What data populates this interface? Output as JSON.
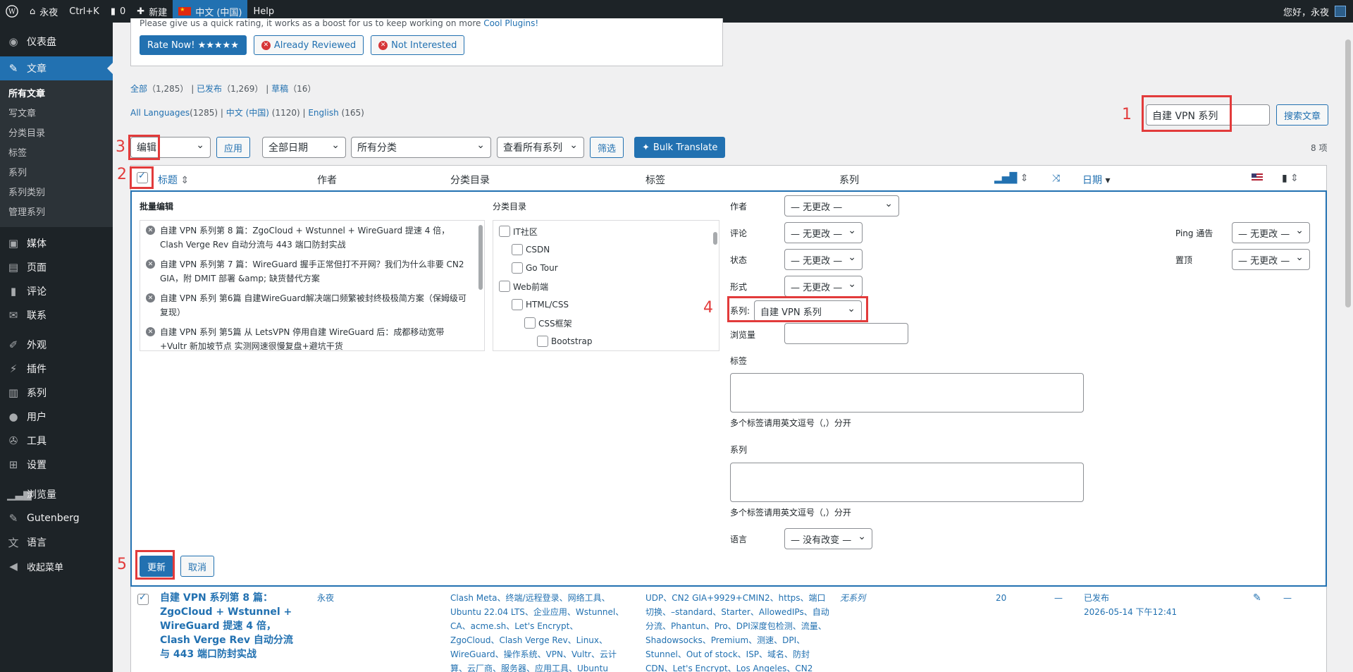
{
  "admin_bar": {
    "site": "永夜",
    "shortcut": "Ctrl+K",
    "comments": "0",
    "new": "新建",
    "language": "中文 (中国)",
    "help": "Help",
    "greeting": "您好，永夜"
  },
  "sidebar": {
    "items": [
      {
        "label": "仪表盘",
        "icon": "dashboard-icon"
      },
      {
        "label": "文章",
        "icon": "pin-icon"
      },
      {
        "label": "媒体",
        "icon": "media-icon"
      },
      {
        "label": "页面",
        "icon": "page-icon"
      },
      {
        "label": "评论",
        "icon": "comment-icon"
      },
      {
        "label": "联系",
        "icon": "mail-icon"
      },
      {
        "label": "外观",
        "icon": "brush-icon"
      },
      {
        "label": "插件",
        "icon": "plugin-icon"
      },
      {
        "label": "系列",
        "icon": "book-icon"
      },
      {
        "label": "用户",
        "icon": "user-icon"
      },
      {
        "label": "工具",
        "icon": "wrench-icon"
      },
      {
        "label": "设置",
        "icon": "settings-icon"
      },
      {
        "label": "浏览量",
        "icon": "chart-icon"
      },
      {
        "label": "Gutenberg",
        "icon": "gutenberg-icon"
      },
      {
        "label": "语言",
        "icon": "translate-icon"
      },
      {
        "label": "收起菜单",
        "icon": "collapse-icon"
      }
    ],
    "submenu": [
      "所有文章",
      "写文章",
      "分类目录",
      "标签",
      "系列",
      "系列类别",
      "管理系列"
    ]
  },
  "notice": {
    "text": "Please give us a quick rating, it works as a boost for us to keep working on more ",
    "link": "Cool Plugins!",
    "rate": "Rate Now! ★★★★★",
    "reviewed": "Already Reviewed",
    "not_interested": "Not Interested"
  },
  "status_links": {
    "all": "全部",
    "all_count": "（1,285）",
    "published": "已发布",
    "published_count": "（1,269）",
    "draft": "草稿",
    "draft_count": "（16）"
  },
  "lang_links": {
    "all": "All Languages",
    "all_count": "(1285)",
    "zh": "中文 (中国)",
    "zh_count": "(1120)",
    "en": "English",
    "en_count": "(165)"
  },
  "search": {
    "value": "自建 VPN 系列",
    "button": "搜索文章"
  },
  "filters": {
    "bulk_action": "编辑",
    "apply": "应用",
    "date": "全部日期",
    "category": "所有分类",
    "series": "查看所有系列",
    "filter": "筛选",
    "translate": "Bulk Translate",
    "count": "8 项"
  },
  "columns": {
    "title": "标题",
    "author": "作者",
    "categories": "分类目录",
    "tags": "标签",
    "series": "系列",
    "date": "日期"
  },
  "bulk_edit": {
    "heading": "批量编辑",
    "cat_heading": "分类目录",
    "posts": [
      "自建 VPN 系列第 8 篇：ZgoCloud + Wstunnel + WireGuard 提速 4 倍，Clash Verge Rev 自动分流与 443 端口防封实战",
      "自建 VPN 系列第 7 篇：WireGuard 握手正常但打不开网？我们为什么非要 CN2 GIA，附 DMIT 部署 &amp; 缺货替代方案",
      "自建 VPN 系列 第6篇 自建WireGuard解决端口频繁被封终极极简方案（保姆级可复现）",
      "自建 VPN 系列 第5篇 从 LetsVPN 停用自建 WireGuard 后：成都移动宽带+Vultr 新加坡节点 实测网速很慢复盘+避坑干货"
    ],
    "cats": [
      "IT社区",
      "CSDN",
      "Go Tour",
      "Web前端",
      "HTML/CSS",
      "CSS框架",
      "Bootstrap"
    ],
    "author_label": "作者",
    "author_value": "— 无更改 —",
    "comment_label": "评论",
    "comment_value": "— 无更改 —",
    "status_label": "状态",
    "status_value": "— 无更改 —",
    "format_label": "形式",
    "format_value": "— 无更改 —",
    "series_label": "系列:",
    "series_value": "自建 VPN 系列",
    "views_label": "浏览量",
    "tags_label": "标签",
    "tags_hint": "多个标签请用英文逗号（,）分开",
    "series2_label": "系列",
    "series2_hint": "多个标签请用英文逗号（,）分开",
    "lang_label": "语言",
    "lang_value": "— 没有改变 —",
    "ping_label": "Ping 通告",
    "ping_value": "— 无更改 —",
    "sticky_label": "置顶",
    "sticky_value": "— 无更改 —",
    "update": "更新",
    "cancel": "取消"
  },
  "annotations": [
    "1",
    "2",
    "3",
    "4",
    "5"
  ],
  "post_row": {
    "title": "自建 VPN 系列第 8 篇：ZgoCloud + Wstunnel + WireGuard 提速 4 倍，Clash Verge Rev 自动分流与 443 端口防封实战",
    "author": "永夜",
    "categories": "Clash Meta、终端/远程登录、网络工具、Ubuntu 22.04 LTS、企业应用、Wstunnel、CA、acme.sh、Let's Encrypt、ZgoCloud、Clash Verge Rev、Linux、WireGuard、操作系统、VPN、Vultr、云计算、云厂商、服务器、应用工具、Ubuntu",
    "tags": "UDP、CN2 GIA+9929+CMIN2、https、端口切换、–standard、Starter、AllowedIPs、自动分流、Phantun、Pro、DPI深度包检测、流量、Shadowsocks、Premium、测速、DPI、Stunnel、Out of stock、ISP、域名、防封 CDN、Let's Encrypt、Los Angeles、CN2",
    "series": "无系列",
    "views": "20",
    "dash": "—",
    "status": "已发布",
    "date": "2026-05-14 下午12:41"
  },
  "colors": {
    "accent": "#2271b1",
    "annotation": "#e23b3b",
    "sidebar": "#1d2327"
  }
}
